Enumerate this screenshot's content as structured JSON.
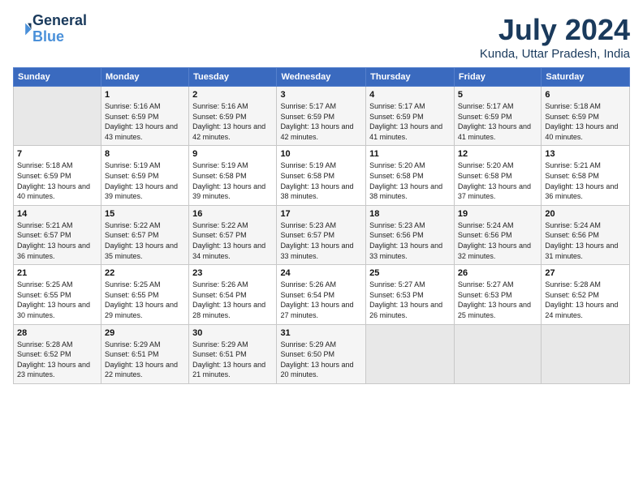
{
  "header": {
    "logo_line1": "General",
    "logo_line2": "Blue",
    "title": "July 2024",
    "location": "Kunda, Uttar Pradesh, India"
  },
  "days_of_week": [
    "Sunday",
    "Monday",
    "Tuesday",
    "Wednesday",
    "Thursday",
    "Friday",
    "Saturday"
  ],
  "weeks": [
    [
      {
        "day": "",
        "sunrise": "",
        "sunset": "",
        "daylight": "",
        "empty": true
      },
      {
        "day": "1",
        "sunrise": "5:16 AM",
        "sunset": "6:59 PM",
        "daylight": "13 hours and 43 minutes."
      },
      {
        "day": "2",
        "sunrise": "5:16 AM",
        "sunset": "6:59 PM",
        "daylight": "13 hours and 42 minutes."
      },
      {
        "day": "3",
        "sunrise": "5:17 AM",
        "sunset": "6:59 PM",
        "daylight": "13 hours and 42 minutes."
      },
      {
        "day": "4",
        "sunrise": "5:17 AM",
        "sunset": "6:59 PM",
        "daylight": "13 hours and 41 minutes."
      },
      {
        "day": "5",
        "sunrise": "5:17 AM",
        "sunset": "6:59 PM",
        "daylight": "13 hours and 41 minutes."
      },
      {
        "day": "6",
        "sunrise": "5:18 AM",
        "sunset": "6:59 PM",
        "daylight": "13 hours and 40 minutes."
      }
    ],
    [
      {
        "day": "7",
        "sunrise": "5:18 AM",
        "sunset": "6:59 PM",
        "daylight": "13 hours and 40 minutes."
      },
      {
        "day": "8",
        "sunrise": "5:19 AM",
        "sunset": "6:59 PM",
        "daylight": "13 hours and 39 minutes."
      },
      {
        "day": "9",
        "sunrise": "5:19 AM",
        "sunset": "6:58 PM",
        "daylight": "13 hours and 39 minutes."
      },
      {
        "day": "10",
        "sunrise": "5:19 AM",
        "sunset": "6:58 PM",
        "daylight": "13 hours and 38 minutes."
      },
      {
        "day": "11",
        "sunrise": "5:20 AM",
        "sunset": "6:58 PM",
        "daylight": "13 hours and 38 minutes."
      },
      {
        "day": "12",
        "sunrise": "5:20 AM",
        "sunset": "6:58 PM",
        "daylight": "13 hours and 37 minutes."
      },
      {
        "day": "13",
        "sunrise": "5:21 AM",
        "sunset": "6:58 PM",
        "daylight": "13 hours and 36 minutes."
      }
    ],
    [
      {
        "day": "14",
        "sunrise": "5:21 AM",
        "sunset": "6:57 PM",
        "daylight": "13 hours and 36 minutes."
      },
      {
        "day": "15",
        "sunrise": "5:22 AM",
        "sunset": "6:57 PM",
        "daylight": "13 hours and 35 minutes."
      },
      {
        "day": "16",
        "sunrise": "5:22 AM",
        "sunset": "6:57 PM",
        "daylight": "13 hours and 34 minutes."
      },
      {
        "day": "17",
        "sunrise": "5:23 AM",
        "sunset": "6:57 PM",
        "daylight": "13 hours and 33 minutes."
      },
      {
        "day": "18",
        "sunrise": "5:23 AM",
        "sunset": "6:56 PM",
        "daylight": "13 hours and 33 minutes."
      },
      {
        "day": "19",
        "sunrise": "5:24 AM",
        "sunset": "6:56 PM",
        "daylight": "13 hours and 32 minutes."
      },
      {
        "day": "20",
        "sunrise": "5:24 AM",
        "sunset": "6:56 PM",
        "daylight": "13 hours and 31 minutes."
      }
    ],
    [
      {
        "day": "21",
        "sunrise": "5:25 AM",
        "sunset": "6:55 PM",
        "daylight": "13 hours and 30 minutes."
      },
      {
        "day": "22",
        "sunrise": "5:25 AM",
        "sunset": "6:55 PM",
        "daylight": "13 hours and 29 minutes."
      },
      {
        "day": "23",
        "sunrise": "5:26 AM",
        "sunset": "6:54 PM",
        "daylight": "13 hours and 28 minutes."
      },
      {
        "day": "24",
        "sunrise": "5:26 AM",
        "sunset": "6:54 PM",
        "daylight": "13 hours and 27 minutes."
      },
      {
        "day": "25",
        "sunrise": "5:27 AM",
        "sunset": "6:53 PM",
        "daylight": "13 hours and 26 minutes."
      },
      {
        "day": "26",
        "sunrise": "5:27 AM",
        "sunset": "6:53 PM",
        "daylight": "13 hours and 25 minutes."
      },
      {
        "day": "27",
        "sunrise": "5:28 AM",
        "sunset": "6:52 PM",
        "daylight": "13 hours and 24 minutes."
      }
    ],
    [
      {
        "day": "28",
        "sunrise": "5:28 AM",
        "sunset": "6:52 PM",
        "daylight": "13 hours and 23 minutes."
      },
      {
        "day": "29",
        "sunrise": "5:29 AM",
        "sunset": "6:51 PM",
        "daylight": "13 hours and 22 minutes."
      },
      {
        "day": "30",
        "sunrise": "5:29 AM",
        "sunset": "6:51 PM",
        "daylight": "13 hours and 21 minutes."
      },
      {
        "day": "31",
        "sunrise": "5:29 AM",
        "sunset": "6:50 PM",
        "daylight": "13 hours and 20 minutes."
      },
      {
        "day": "",
        "sunrise": "",
        "sunset": "",
        "daylight": "",
        "empty": true
      },
      {
        "day": "",
        "sunrise": "",
        "sunset": "",
        "daylight": "",
        "empty": true
      },
      {
        "day": "",
        "sunrise": "",
        "sunset": "",
        "daylight": "",
        "empty": true
      }
    ]
  ]
}
